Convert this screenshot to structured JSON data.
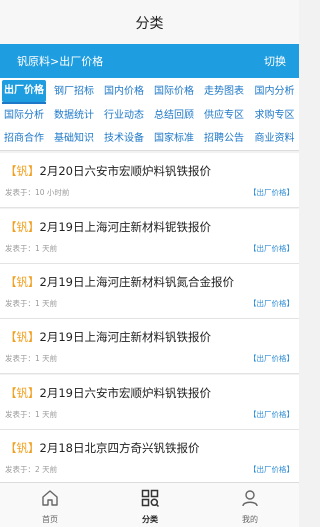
{
  "header": {
    "title": "分类"
  },
  "breadcrumb": {
    "text": "钒原料>出厂价格",
    "switch_label": "切换"
  },
  "tabs": {
    "row1": [
      "出厂价格",
      "钢厂招标",
      "国内价格",
      "国际价格",
      "走势图表",
      "国内分析"
    ],
    "row2": [
      "国际分析",
      "数据统计",
      "行业动态",
      "总结回顾",
      "供应专区",
      "求购专区"
    ],
    "row3": [
      "招商合作",
      "基础知识",
      "技术设备",
      "国家标准",
      "招聘公告",
      "商业资料"
    ]
  },
  "items": [
    {
      "tag": "【钒】",
      "title": "2月20日六安市宏顺炉料钒铁报价",
      "meta": "发表于：10 小时前",
      "category": "【出厂价格】"
    },
    {
      "tag": "【钒】",
      "title": "2月19日上海河庄新材料铌铁报价",
      "meta": "发表于：1 天前",
      "category": "【出厂价格】"
    },
    {
      "tag": "【钒】",
      "title": "2月19日上海河庄新材料钒氮合金报价",
      "meta": "发表于：1 天前",
      "category": "【出厂价格】"
    },
    {
      "tag": "【钒】",
      "title": "2月19日上海河庄新材料钒铁报价",
      "meta": "发表于：1 天前",
      "category": "【出厂价格】"
    },
    {
      "tag": "【钒】",
      "title": "2月19日六安市宏顺炉料钒铁报价",
      "meta": "发表于：1 天前",
      "category": "【出厂价格】"
    },
    {
      "tag": "【钒】",
      "title": "2月18日北京四方奇兴钒铁报价",
      "meta": "发表于：2 天前",
      "category": "【出厂价格】"
    }
  ],
  "tabbar": {
    "home": "首页",
    "category": "分类",
    "mine": "我的"
  },
  "colors": {
    "accent": "#1e9de0",
    "tag": "#f0a020",
    "link": "#2a8ad4"
  }
}
